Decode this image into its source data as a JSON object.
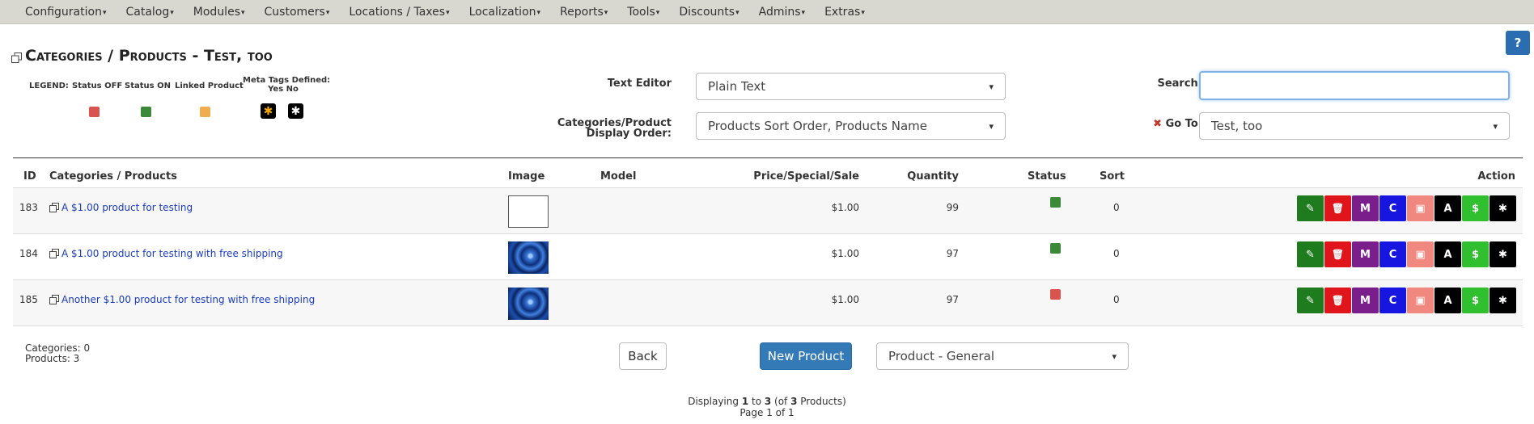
{
  "nav": {
    "items": [
      "Configuration",
      "Catalog",
      "Modules",
      "Customers",
      "Locations / Taxes",
      "Localization",
      "Reports",
      "Tools",
      "Discounts",
      "Admins",
      "Extras"
    ],
    "caret": "▾"
  },
  "help": {
    "label": "?"
  },
  "page": {
    "title": "Categories / Products - Test, too"
  },
  "legend": {
    "title": "LEGEND:",
    "status_off": "Status OFF",
    "status_on": "Status ON",
    "linked": "Linked Product",
    "meta_line1": "Meta Tags Defined:",
    "meta_line2": "Yes No",
    "colors": {
      "off": "#d9534f",
      "on": "#3a8a3a",
      "linked": "#f0ad4e",
      "meta_yes_star": "#f0a500",
      "meta_no_star": "#ffffff"
    }
  },
  "form": {
    "text_editor_label": "Text Editor",
    "text_editor_value": "Plain Text",
    "display_order_label_1": "Categories/Product",
    "display_order_label_2": "Display Order:",
    "display_order_value": "Products Sort Order, Products Name",
    "search_label": "Search:",
    "search_value": "",
    "goto_icon": "✖",
    "goto_label": "Go To:",
    "goto_value": "Test, too"
  },
  "table": {
    "headers": {
      "id": "ID",
      "name": "Categories / Products",
      "image": "Image",
      "model": "Model",
      "price": "Price/Special/Sale",
      "quantity": "Quantity",
      "status": "Status",
      "sort": "Sort",
      "action": "Action"
    },
    "rows": [
      {
        "id": "183",
        "name": "A $1.00 product for testing",
        "image": "empty",
        "model": "",
        "price": "$1.00",
        "quantity": "99",
        "status": "on",
        "status_color": "#3a8a3a",
        "sort": "0"
      },
      {
        "id": "184",
        "name": "A $1.00 product for testing with free shipping",
        "image": "rose",
        "model": "",
        "price": "$1.00",
        "quantity": "97",
        "status": "on",
        "status_color": "#3a8a3a",
        "sort": "0"
      },
      {
        "id": "185",
        "name": "Another $1.00 product for testing with free shipping",
        "image": "rose",
        "model": "",
        "price": "$1.00",
        "quantity": "97",
        "status": "off",
        "status_color": "#d9534f",
        "sort": "0"
      }
    ],
    "action_buttons": [
      {
        "key": "edit",
        "icon": "pencil-icon",
        "glyph": "✎",
        "color": "#1e7b1e"
      },
      {
        "key": "delete",
        "icon": "trash-icon",
        "glyph": "🗑",
        "color": "#e0141b"
      },
      {
        "key": "move",
        "icon": "move-icon",
        "glyph": "M",
        "color": "#7a1e8c"
      },
      {
        "key": "copy",
        "icon": "copy-icon",
        "glyph": "C",
        "color": "#1616e0"
      },
      {
        "key": "images",
        "icon": "image-icon",
        "glyph": "▣",
        "color": "#f08880"
      },
      {
        "key": "attributes",
        "icon": "attributes-icon",
        "glyph": "A",
        "color": "#000000"
      },
      {
        "key": "pricing",
        "icon": "dollar-icon",
        "glyph": "$",
        "color": "#2fbf2f"
      },
      {
        "key": "metatags",
        "icon": "asterisk-icon",
        "glyph": "✱",
        "color": "#000000"
      }
    ]
  },
  "footer": {
    "categories_count": "Categories: 0",
    "products_count": "Products: 3",
    "back_label": "Back",
    "new_product_label": "New Product",
    "product_type_value": "Product - General",
    "displaying_prefix": "Displaying ",
    "displaying_from": "1",
    "displaying_to_word": " to ",
    "displaying_to": "3",
    "displaying_of_word": " (of ",
    "displaying_total": "3",
    "displaying_suffix": " Products)",
    "page_info": "Page 1 of 1"
  }
}
